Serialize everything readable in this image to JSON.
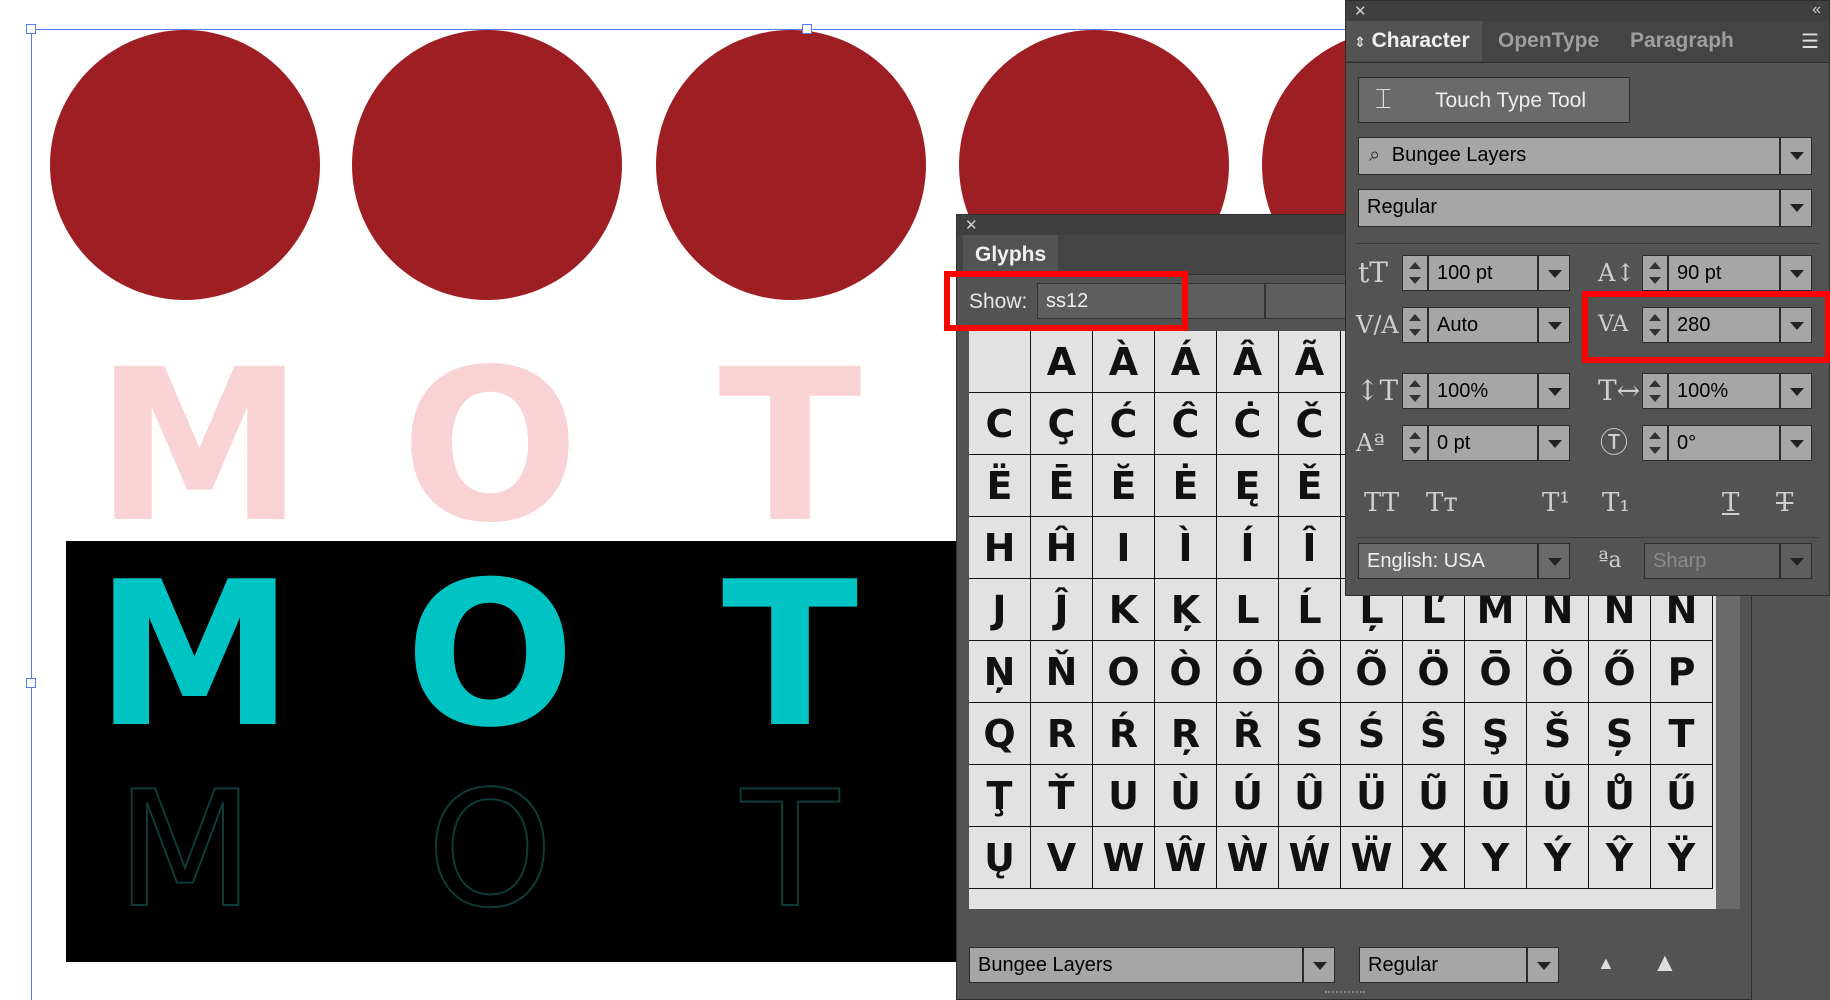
{
  "artboard": {
    "circle_color": "#9d1e23",
    "pink_letters": [
      "M",
      "O",
      "T"
    ],
    "teal_letters": [
      "M",
      "O",
      "T"
    ],
    "outline_letters": [
      "M",
      "O",
      "T"
    ],
    "pink_color": "#f9d3d3",
    "teal_color": "#00c4c4"
  },
  "glyphs_panel": {
    "tab": "Glyphs",
    "show_label": "Show:",
    "show_value": "ss12",
    "font_family": "Bungee Layers",
    "font_style": "Regular",
    "rows": [
      [
        "",
        "A",
        "À",
        "Á",
        "Â",
        "Ã",
        "",
        "",
        "",
        "",
        "",
        "",
        ""
      ],
      [
        "C",
        "Ç",
        "Ć",
        "Ĉ",
        "Ċ",
        "Č",
        "",
        "",
        "",
        "",
        "",
        "",
        ""
      ],
      [
        "Ë",
        "Ē",
        "Ĕ",
        "Ė",
        "Ę",
        "Ě",
        "",
        "",
        "",
        "",
        "",
        "",
        ""
      ],
      [
        "H",
        "Ĥ",
        "I",
        "Ì",
        "Í",
        "Î",
        "",
        "",
        "",
        "",
        "",
        "",
        ""
      ],
      [
        "J",
        "Ĵ",
        "K",
        "Ķ",
        "L",
        "Ĺ",
        "Ļ",
        "Ľ",
        "M",
        "N",
        "Ñ",
        "Ń"
      ],
      [
        "Ņ",
        "Ň",
        "O",
        "Ò",
        "Ó",
        "Ô",
        "Õ",
        "Ö",
        "Ō",
        "Ŏ",
        "Ő",
        "P"
      ],
      [
        "Q",
        "R",
        "Ŕ",
        "Ŗ",
        "Ř",
        "S",
        "Ś",
        "Ŝ",
        "Ş",
        "Š",
        "Ș",
        "T"
      ],
      [
        "Ţ",
        "Ť",
        "U",
        "Ù",
        "Ú",
        "Û",
        "Ü",
        "Ũ",
        "Ū",
        "Ŭ",
        "Ů",
        "Ű"
      ],
      [
        "Ų",
        "V",
        "W",
        "Ŵ",
        "Ẁ",
        "Ẃ",
        "Ẅ",
        "X",
        "Y",
        "Ý",
        "Ŷ",
        "Ÿ"
      ]
    ]
  },
  "character_panel": {
    "tabs": [
      "Character",
      "OpenType",
      "Paragraph"
    ],
    "touch_type_label": "Touch Type Tool",
    "font_family": "Bungee Layers",
    "font_style": "Regular",
    "font_size": "100 pt",
    "leading": "90 pt",
    "kerning": "Auto",
    "tracking": "280",
    "vertical_scale": "100%",
    "horizontal_scale": "100%",
    "baseline_shift": "0 pt",
    "rotation": "0°",
    "language": "English: USA",
    "antialias": "Sharp"
  }
}
